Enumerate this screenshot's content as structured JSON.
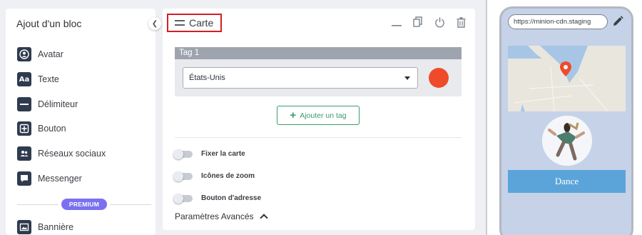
{
  "sidebar": {
    "title": "Ajout d'un bloc",
    "items": [
      {
        "label": "Avatar",
        "icon": "avatar-icon"
      },
      {
        "label": "Texte",
        "icon": "text-icon"
      },
      {
        "label": "Délimiteur",
        "icon": "divider-icon"
      },
      {
        "label": "Bouton",
        "icon": "plus-square-icon"
      },
      {
        "label": "Réseaux sociaux",
        "icon": "people-icon"
      },
      {
        "label": "Messenger",
        "icon": "chat-bubble-icon"
      }
    ],
    "premium_label": "PREMIUM",
    "premium_items": [
      {
        "label": "Bannière",
        "icon": "image-icon"
      }
    ]
  },
  "panel": {
    "title": "Carte",
    "tag": {
      "header": "Tag 1",
      "country": "États-Unis",
      "color": "#ef4b2a"
    },
    "add_tag_label": "Ajouter un tag",
    "toggles": [
      {
        "label": "Fixer la carte",
        "on": false
      },
      {
        "label": "Icônes de zoom",
        "on": false
      },
      {
        "label": "Bouton d'adresse",
        "on": false
      }
    ],
    "advanced_label": "Paramètres Avancés"
  },
  "preview": {
    "url": "https://minion-cdn.staging",
    "button_label": "Dance",
    "button_color": "#5aa4d9",
    "marker_color": "#ef4b2a"
  }
}
